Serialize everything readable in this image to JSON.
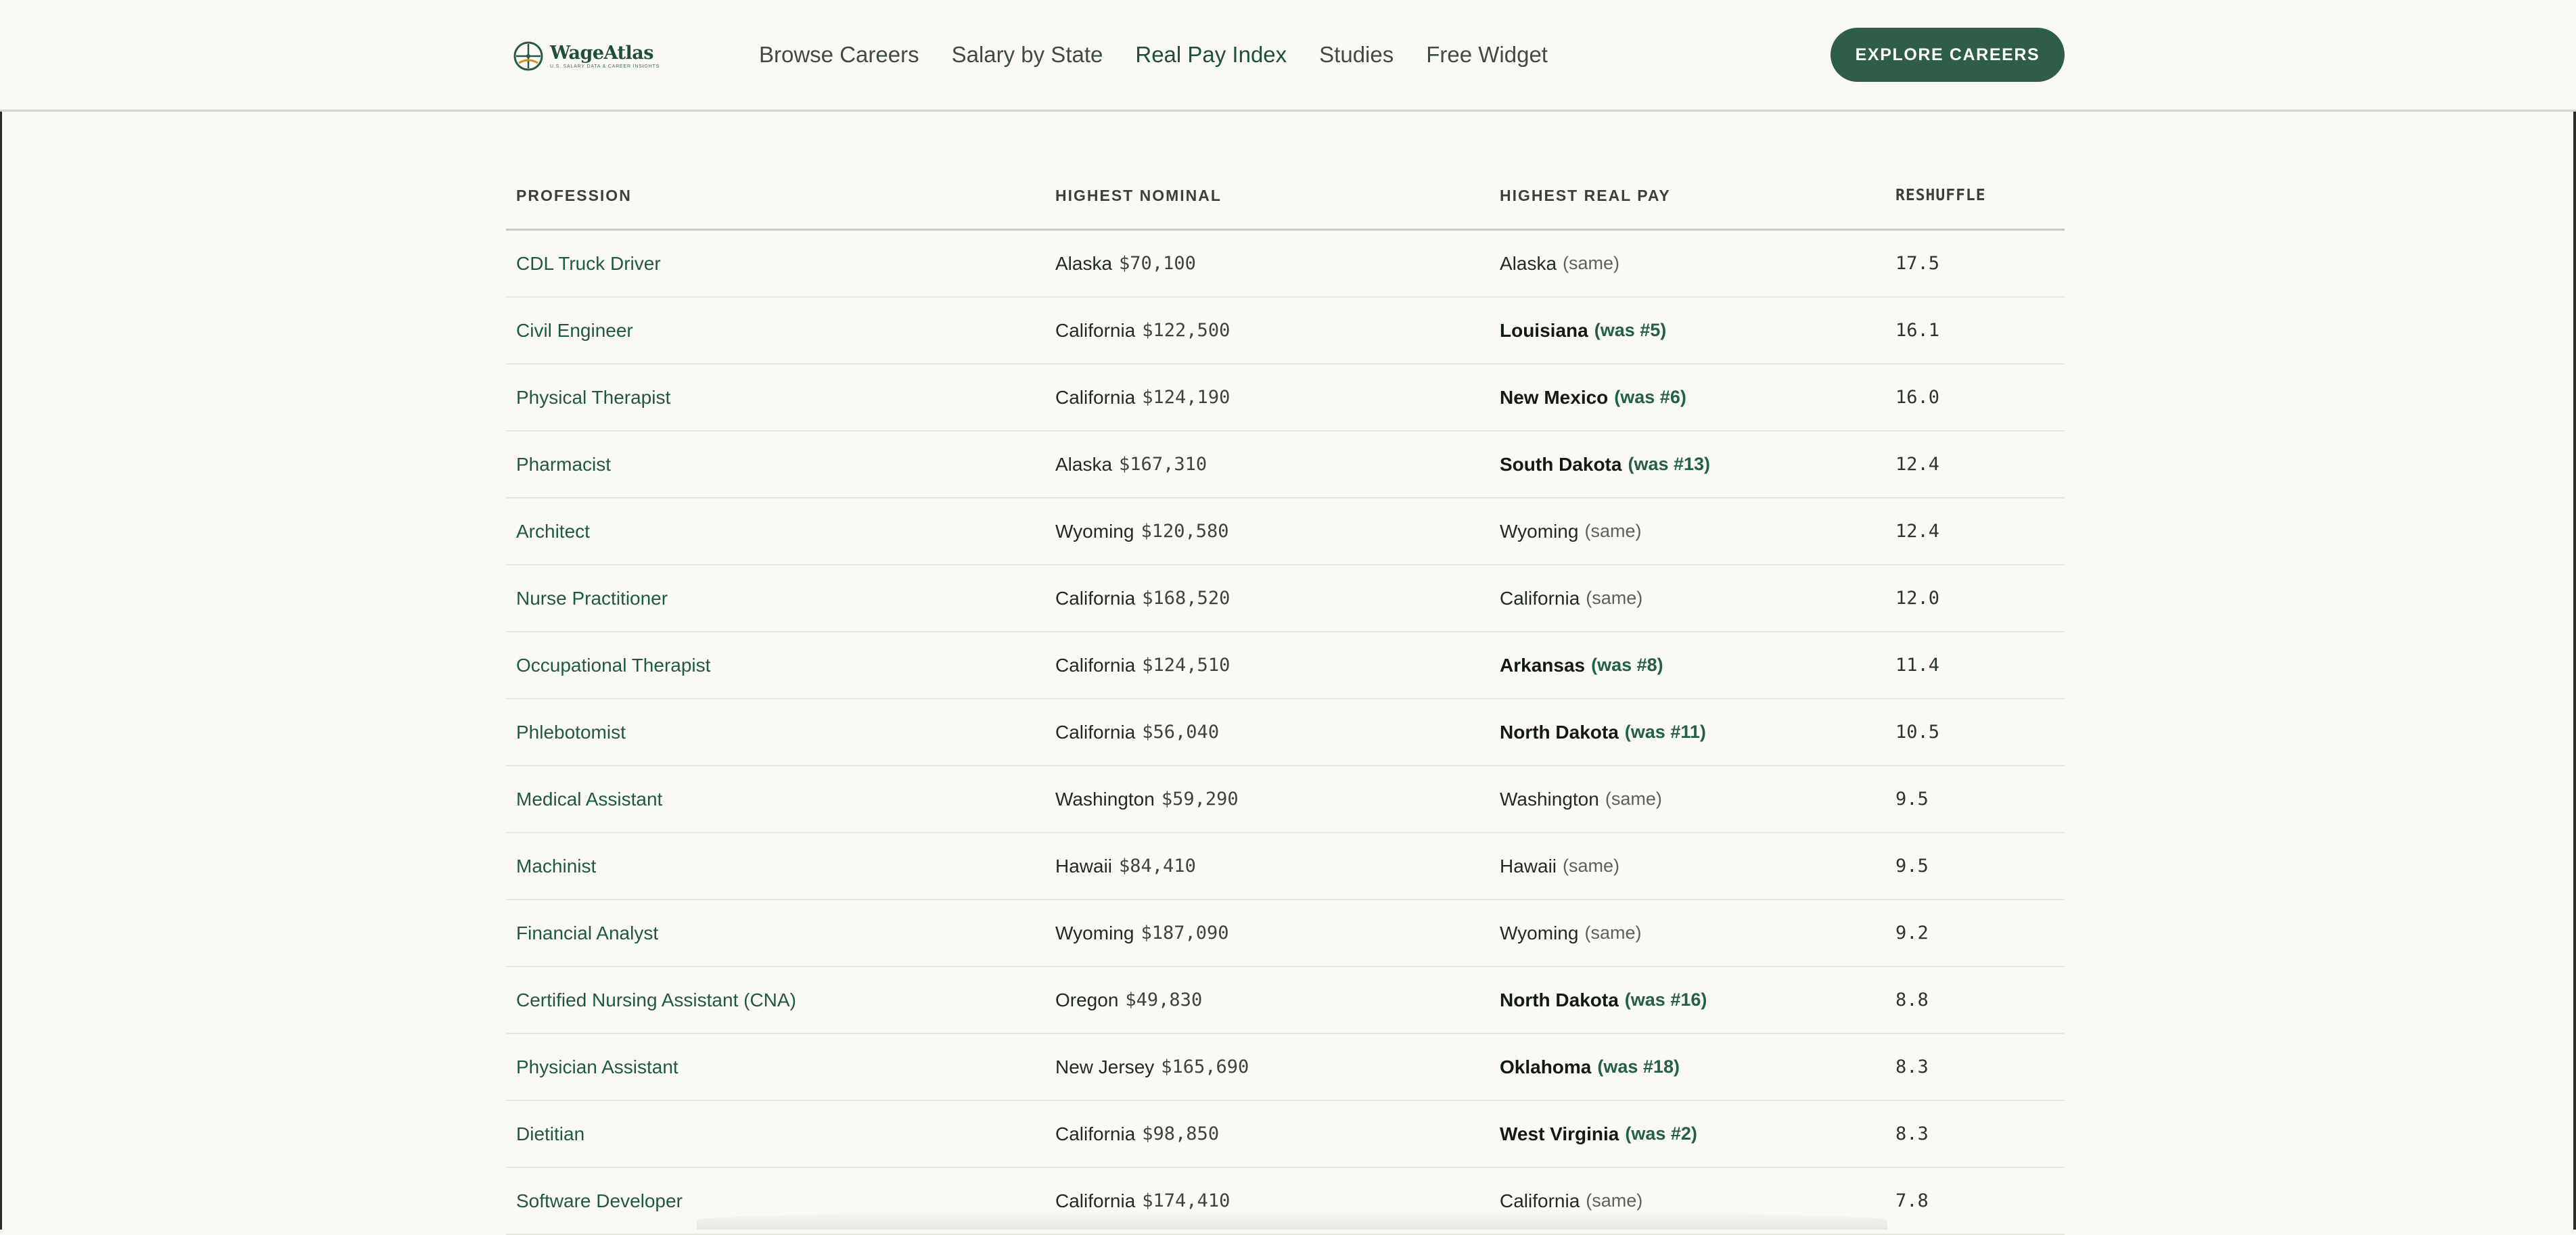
{
  "header": {
    "logo_name": "WageAtlas",
    "logo_tagline": "U.S. SALARY DATA & CAREER INSIGHTS",
    "nav": [
      {
        "label": "Browse Careers",
        "active": false
      },
      {
        "label": "Salary by State",
        "active": false
      },
      {
        "label": "Real Pay Index",
        "active": true
      },
      {
        "label": "Studies",
        "active": false
      },
      {
        "label": "Free Widget",
        "active": false
      }
    ],
    "cta_label": "EXPLORE CAREERS"
  },
  "table": {
    "columns": [
      "PROFESSION",
      "HIGHEST NOMINAL",
      "HIGHEST REAL PAY",
      "RESHUFFLE"
    ],
    "rows": [
      {
        "profession": "CDL Truck Driver",
        "nominal_state": "Alaska",
        "nominal_pay": "$70,100",
        "real_state": "Alaska",
        "real_note": "(same)",
        "changed": false,
        "reshuffle": "17.5"
      },
      {
        "profession": "Civil Engineer",
        "nominal_state": "California",
        "nominal_pay": "$122,500",
        "real_state": "Louisiana",
        "real_note": "(was #5)",
        "changed": true,
        "reshuffle": "16.1"
      },
      {
        "profession": "Physical Therapist",
        "nominal_state": "California",
        "nominal_pay": "$124,190",
        "real_state": "New Mexico",
        "real_note": "(was #6)",
        "changed": true,
        "reshuffle": "16.0"
      },
      {
        "profession": "Pharmacist",
        "nominal_state": "Alaska",
        "nominal_pay": "$167,310",
        "real_state": "South Dakota",
        "real_note": "(was #13)",
        "changed": true,
        "reshuffle": "12.4"
      },
      {
        "profession": "Architect",
        "nominal_state": "Wyoming",
        "nominal_pay": "$120,580",
        "real_state": "Wyoming",
        "real_note": "(same)",
        "changed": false,
        "reshuffle": "12.4"
      },
      {
        "profession": "Nurse Practitioner",
        "nominal_state": "California",
        "nominal_pay": "$168,520",
        "real_state": "California",
        "real_note": "(same)",
        "changed": false,
        "reshuffle": "12.0"
      },
      {
        "profession": "Occupational Therapist",
        "nominal_state": "California",
        "nominal_pay": "$124,510",
        "real_state": "Arkansas",
        "real_note": "(was #8)",
        "changed": true,
        "reshuffle": "11.4"
      },
      {
        "profession": "Phlebotomist",
        "nominal_state": "California",
        "nominal_pay": "$56,040",
        "real_state": "North Dakota",
        "real_note": "(was #11)",
        "changed": true,
        "reshuffle": "10.5"
      },
      {
        "profession": "Medical Assistant",
        "nominal_state": "Washington",
        "nominal_pay": "$59,290",
        "real_state": "Washington",
        "real_note": "(same)",
        "changed": false,
        "reshuffle": "9.5"
      },
      {
        "profession": "Machinist",
        "nominal_state": "Hawaii",
        "nominal_pay": "$84,410",
        "real_state": "Hawaii",
        "real_note": "(same)",
        "changed": false,
        "reshuffle": "9.5"
      },
      {
        "profession": "Financial Analyst",
        "nominal_state": "Wyoming",
        "nominal_pay": "$187,090",
        "real_state": "Wyoming",
        "real_note": "(same)",
        "changed": false,
        "reshuffle": "9.2"
      },
      {
        "profession": "Certified Nursing Assistant (CNA)",
        "nominal_state": "Oregon",
        "nominal_pay": "$49,830",
        "real_state": "North Dakota",
        "real_note": "(was #16)",
        "changed": true,
        "reshuffle": "8.8"
      },
      {
        "profession": "Physician Assistant",
        "nominal_state": "New Jersey",
        "nominal_pay": "$165,690",
        "real_state": "Oklahoma",
        "real_note": "(was #18)",
        "changed": true,
        "reshuffle": "8.3"
      },
      {
        "profession": "Dietitian",
        "nominal_state": "California",
        "nominal_pay": "$98,850",
        "real_state": "West Virginia",
        "real_note": "(was #2)",
        "changed": true,
        "reshuffle": "8.3"
      },
      {
        "profession": "Software Developer",
        "nominal_state": "California",
        "nominal_pay": "$174,410",
        "real_state": "California",
        "real_note": "(same)",
        "changed": false,
        "reshuffle": "7.8"
      }
    ]
  }
}
